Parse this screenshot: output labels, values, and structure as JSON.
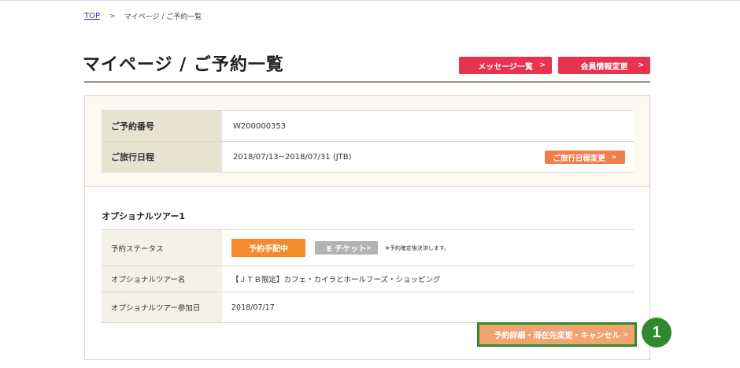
{
  "breadcrumb": {
    "top_label": "TOP",
    "separator": ">",
    "current": "マイページ / ご予約一覧"
  },
  "page": {
    "title": "マイページ / ご予約一覧"
  },
  "header_buttons": {
    "messages_label": "メッセージ一覧",
    "member_label": "会員情報変更",
    "chevron": ">"
  },
  "summary": {
    "rows": [
      {
        "label": "ご予約番号",
        "value": "W200000353"
      },
      {
        "label": "ご旅行日程",
        "value": "2018/07/13~2018/07/31 (JTB)"
      }
    ],
    "date_change_label": "ご旅行日程変更",
    "chevron": ">"
  },
  "tour": {
    "section_title": "オプショナルツアー1",
    "status_label": "予約ステータス",
    "status_value": "予約手配中",
    "eticket_label": "E チケット",
    "eticket_note": "※予約確定後決済します。",
    "name_label": "オプショナルツアー名",
    "name_value": "【ＪＴＢ限定】カフェ・カイラとホールフーズ・ショッピング",
    "date_label": "オプショナルツアー参加日",
    "date_value": "2018/07/17",
    "chevron": ">"
  },
  "detail_button": {
    "label": "予約詳細・滞在先変更・キャンセル",
    "chevron": ">"
  },
  "annotation": {
    "marker_number": "1",
    "marker_color": "#2f8a2e"
  },
  "colors": {
    "brand_red": "#e8334f",
    "accent_orange": "#ef7e4a",
    "status_orange": "#f48a2c",
    "disabled_gray": "#b3b3b3",
    "label_beige": "#e7e3d1"
  }
}
